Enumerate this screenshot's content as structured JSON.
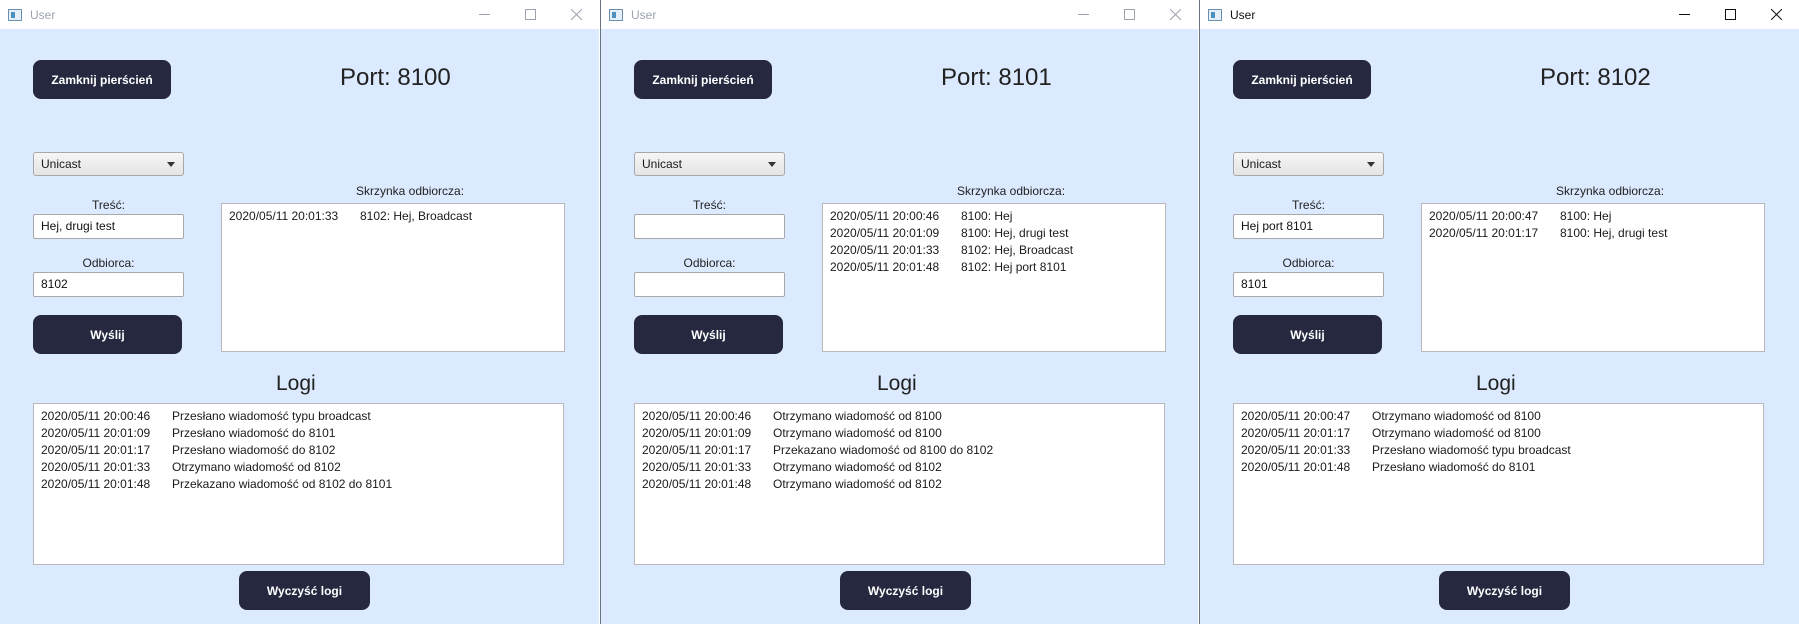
{
  "windows": [
    {
      "title": "User",
      "close_ring_label": "Zamknij pierścień",
      "port_label": "Port: 8100",
      "mode_select": "Unicast",
      "content_label": "Treść:",
      "content_value": "Hej, drugi test",
      "recipient_label": "Odbiorca:",
      "recipient_value": "8102",
      "send_label": "Wyślij",
      "inbox_label": "Skrzynka odbiorcza:",
      "inbox": [
        {
          "ts": "2020/05/11 20:01:33",
          "msg": "8102: Hej, Broadcast"
        }
      ],
      "logs_title": "Logi",
      "logs": [
        {
          "ts": "2020/05/11 20:00:46",
          "msg": "Przesłano wiadomość typu broadcast"
        },
        {
          "ts": "2020/05/11 20:01:09",
          "msg": "Przesłano wiadomość do 8101"
        },
        {
          "ts": "2020/05/11 20:01:17",
          "msg": "Przesłano wiadomość do 8102"
        },
        {
          "ts": "2020/05/11 20:01:33",
          "msg": "Otrzymano wiadomość od 8102"
        },
        {
          "ts": "2020/05/11 20:01:48",
          "msg": "Przekazano wiadomość od 8102 do 8101"
        }
      ],
      "clear_logs_label": "Wyczyść logi"
    },
    {
      "title": "User",
      "close_ring_label": "Zamknij pierścień",
      "port_label": "Port: 8101",
      "mode_select": "Unicast",
      "content_label": "Treść:",
      "content_value": "",
      "recipient_label": "Odbiorca:",
      "recipient_value": "",
      "send_label": "Wyślij",
      "inbox_label": "Skrzynka odbiorcza:",
      "inbox": [
        {
          "ts": "2020/05/11 20:00:46",
          "msg": "8100: Hej"
        },
        {
          "ts": "2020/05/11 20:01:09",
          "msg": "8100: Hej, drugi test"
        },
        {
          "ts": "2020/05/11 20:01:33",
          "msg": "8102: Hej, Broadcast"
        },
        {
          "ts": "2020/05/11 20:01:48",
          "msg": "8102: Hej port 8101"
        }
      ],
      "logs_title": "Logi",
      "logs": [
        {
          "ts": "2020/05/11 20:00:46",
          "msg": "Otrzymano wiadomość od 8100"
        },
        {
          "ts": "2020/05/11 20:01:09",
          "msg": "Otrzymano wiadomość od 8100"
        },
        {
          "ts": "2020/05/11 20:01:17",
          "msg": "Przekazano wiadomość od 8100 do 8102"
        },
        {
          "ts": "2020/05/11 20:01:33",
          "msg": "Otrzymano wiadomość od 8102"
        },
        {
          "ts": "2020/05/11 20:01:48",
          "msg": "Otrzymano wiadomość od 8102"
        }
      ],
      "clear_logs_label": "Wyczyść logi"
    },
    {
      "title": "User",
      "close_ring_label": "Zamknij pierścień",
      "port_label": "Port: 8102",
      "mode_select": "Unicast",
      "content_label": "Treść:",
      "content_value": "Hej port 8101",
      "recipient_label": "Odbiorca:",
      "recipient_value": "8101",
      "send_label": "Wyślij",
      "inbox_label": "Skrzynka odbiorcza:",
      "inbox": [
        {
          "ts": "2020/05/11 20:00:47",
          "msg": "8100: Hej"
        },
        {
          "ts": "2020/05/11 20:01:17",
          "msg": "8100: Hej, drugi test"
        }
      ],
      "logs_title": "Logi",
      "logs": [
        {
          "ts": "2020/05/11 20:00:47",
          "msg": "Otrzymano wiadomość od 8100"
        },
        {
          "ts": "2020/05/11 20:01:17",
          "msg": "Otrzymano wiadomość od 8100"
        },
        {
          "ts": "2020/05/11 20:01:33",
          "msg": "Przesłano wiadomość typu broadcast"
        },
        {
          "ts": "2020/05/11 20:01:48",
          "msg": "Przesłano wiadomość do 8101"
        }
      ],
      "clear_logs_label": "Wyczyść logi"
    }
  ],
  "colors": {
    "window_bg": "#dbeafe",
    "button_bg": "#262840",
    "button_text": "#ffffff"
  },
  "icons": {
    "app": "app-window-icon",
    "minimize": "minimize-icon",
    "maximize": "maximize-icon",
    "close": "close-icon"
  }
}
